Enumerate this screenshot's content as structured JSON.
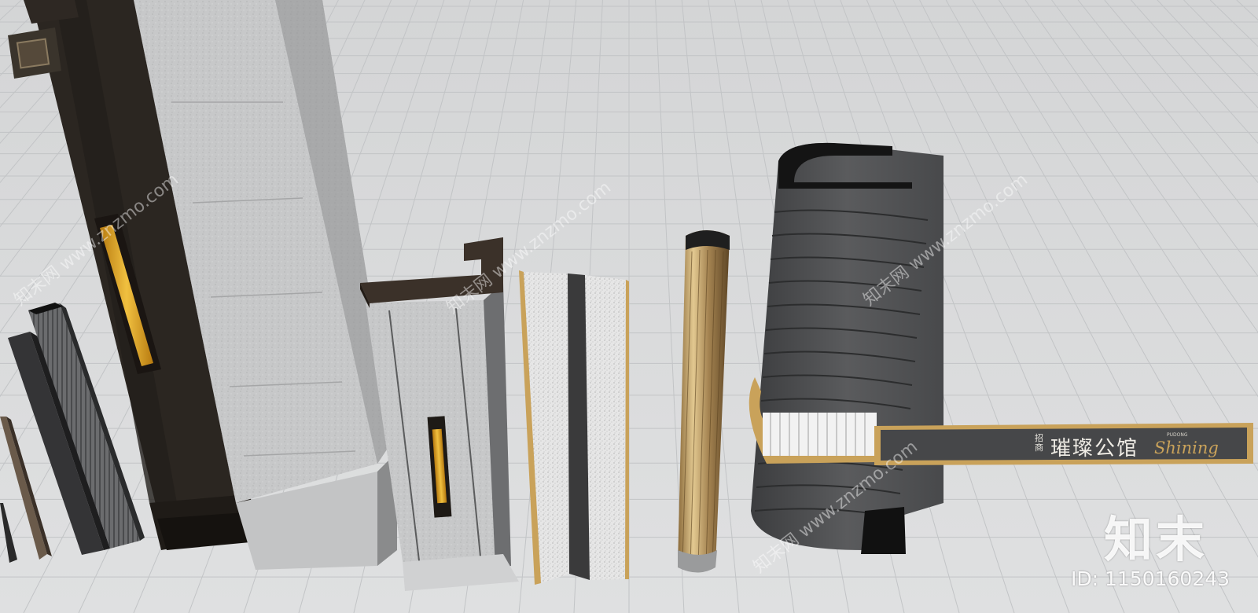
{
  "watermarks": {
    "logo": "知末",
    "id_text": "ID: 1150160243",
    "diagonal": [
      "知末网 www.znzmo.com",
      "知末网 www.znzmo.com",
      "知末网 www.znzmo.com",
      "知末网 www.znzmo.com"
    ]
  },
  "sign": {
    "small_top": "招商",
    "name": "璀璨公馆",
    "tiny_en": "PUDONG",
    "script_en": "Shining"
  },
  "colors": {
    "floor": "#d9dadb",
    "grid_line": "#bfc1c3",
    "dark_wood": "#2a2520",
    "gold": "#c9a25a",
    "amber_glow": "#e2a91c",
    "concrete": "#c8c9ca",
    "charcoal": "#4a4b4d",
    "sign_panel": "#454648"
  }
}
